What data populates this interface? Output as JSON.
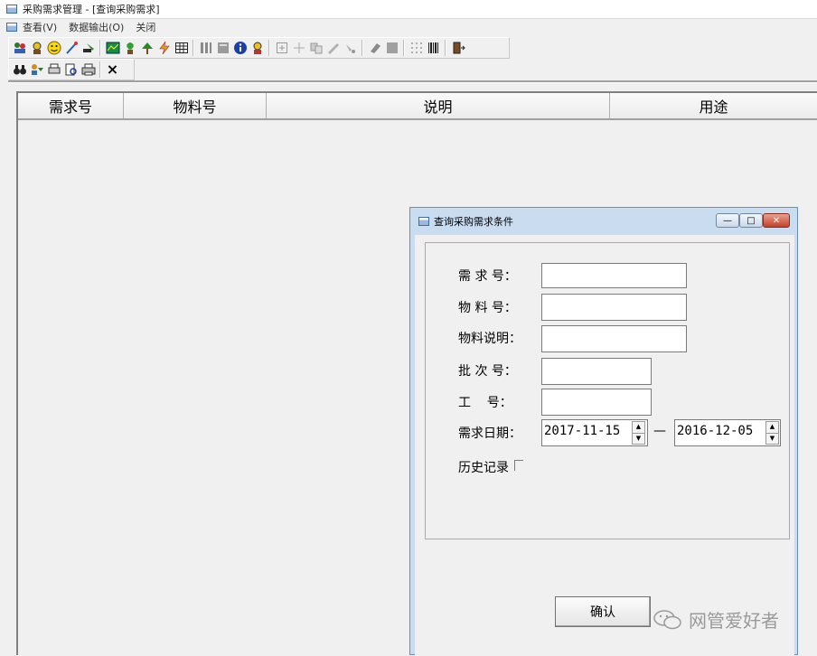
{
  "window": {
    "title": "采购需求管理 - [查询采购需求]"
  },
  "menu": {
    "items": [
      "查看(V)",
      "数据输出(O)",
      "关闭"
    ]
  },
  "toolbar2": {
    "close_symbol": "×"
  },
  "grid": {
    "columns": [
      "需求号",
      "物料号",
      "说明",
      "用途"
    ]
  },
  "dialog": {
    "title": "查询采购需求条件",
    "window_buttons": {
      "minimize": "—",
      "maximize": "□",
      "close": "✕"
    },
    "fields": {
      "req_no_label": "需 求 号：",
      "material_no_label": "物 料 号：",
      "material_desc_label": "物料说明：",
      "batch_no_label": "批 次 号：",
      "work_no_label": "工    号：",
      "date_label": "需求日期：",
      "date_from": "2017-11-15",
      "date_separator": "—",
      "date_to": "2016-12-05",
      "history_label": "历史记录"
    },
    "confirm_label": "确认"
  },
  "watermark": {
    "text": "网管爱好者"
  }
}
